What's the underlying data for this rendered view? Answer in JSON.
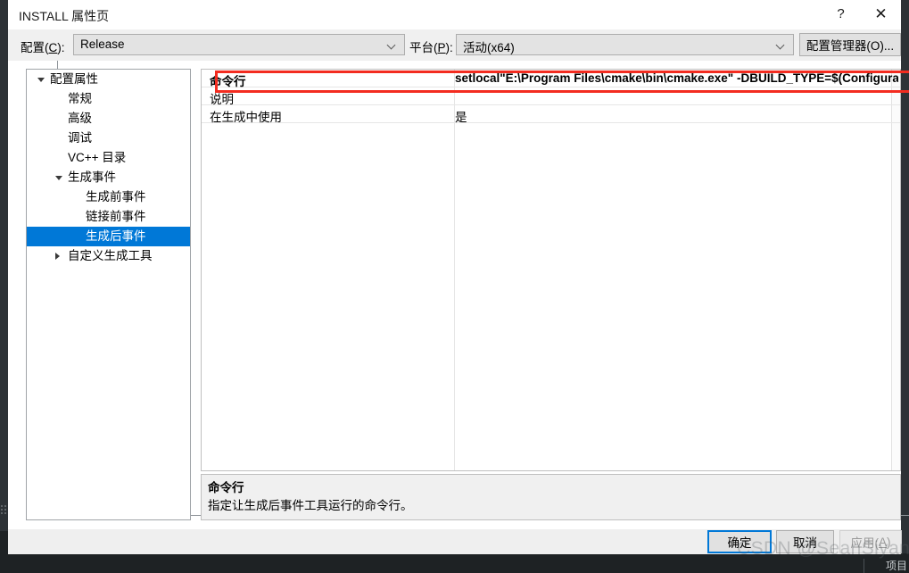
{
  "window": {
    "title": "INSTALL 属性页",
    "help_glyph": "?",
    "close_glyph": "✕"
  },
  "config_bar": {
    "configuration_label_pre": "配置(",
    "configuration_label_key": "C",
    "configuration_label_post": "):",
    "configuration_value": "Release",
    "platform_label_pre": "平台(",
    "platform_label_key": "P",
    "platform_label_post": "):",
    "platform_value": "活动(x64)",
    "config_manager_button": "配置管理器(O)..."
  },
  "tree": {
    "items": [
      {
        "label": "配置属性",
        "indent": 0,
        "arrow": "open",
        "selected": false
      },
      {
        "label": "常规",
        "indent": 1,
        "arrow": "none",
        "selected": false
      },
      {
        "label": "高级",
        "indent": 1,
        "arrow": "none",
        "selected": false
      },
      {
        "label": "调试",
        "indent": 1,
        "arrow": "none",
        "selected": false
      },
      {
        "label": "VC++ 目录",
        "indent": 1,
        "arrow": "none",
        "selected": false
      },
      {
        "label": "生成事件",
        "indent": 1,
        "arrow": "open",
        "selected": false
      },
      {
        "label": "生成前事件",
        "indent": 2,
        "arrow": "none",
        "selected": false
      },
      {
        "label": "链接前事件",
        "indent": 2,
        "arrow": "none",
        "selected": false
      },
      {
        "label": "生成后事件",
        "indent": 2,
        "arrow": "none",
        "selected": true
      },
      {
        "label": "自定义生成工具",
        "indent": 1,
        "arrow": "closed",
        "selected": false
      }
    ]
  },
  "grid": {
    "rows": [
      {
        "name": "命令行",
        "value": "setlocal\"E:\\Program Files\\cmake\\bin\\cmake.exe\" -DBUILD_TYPE=$(Configuratio",
        "highlighted": true
      },
      {
        "name": "说明",
        "value": "",
        "highlighted": false
      },
      {
        "name": "在生成中使用",
        "value": "是",
        "highlighted": false
      }
    ]
  },
  "description": {
    "title": "命令行",
    "text": "指定让生成后事件工具运行的命令行。"
  },
  "footer": {
    "ok_label": "确定",
    "cancel_label": "取消",
    "apply_label_pre": "应用(",
    "apply_label_key": "A",
    "apply_label_post": ")"
  },
  "watermark": {
    "text": "CSDN @SeanSiyang"
  },
  "background": {
    "tab_label": "项目"
  },
  "colors": {
    "accent": "#0078d7",
    "annotation_red": "#f32c20",
    "dialog_bg": "#ffffff",
    "panel_bg": "#f0f0f0"
  }
}
